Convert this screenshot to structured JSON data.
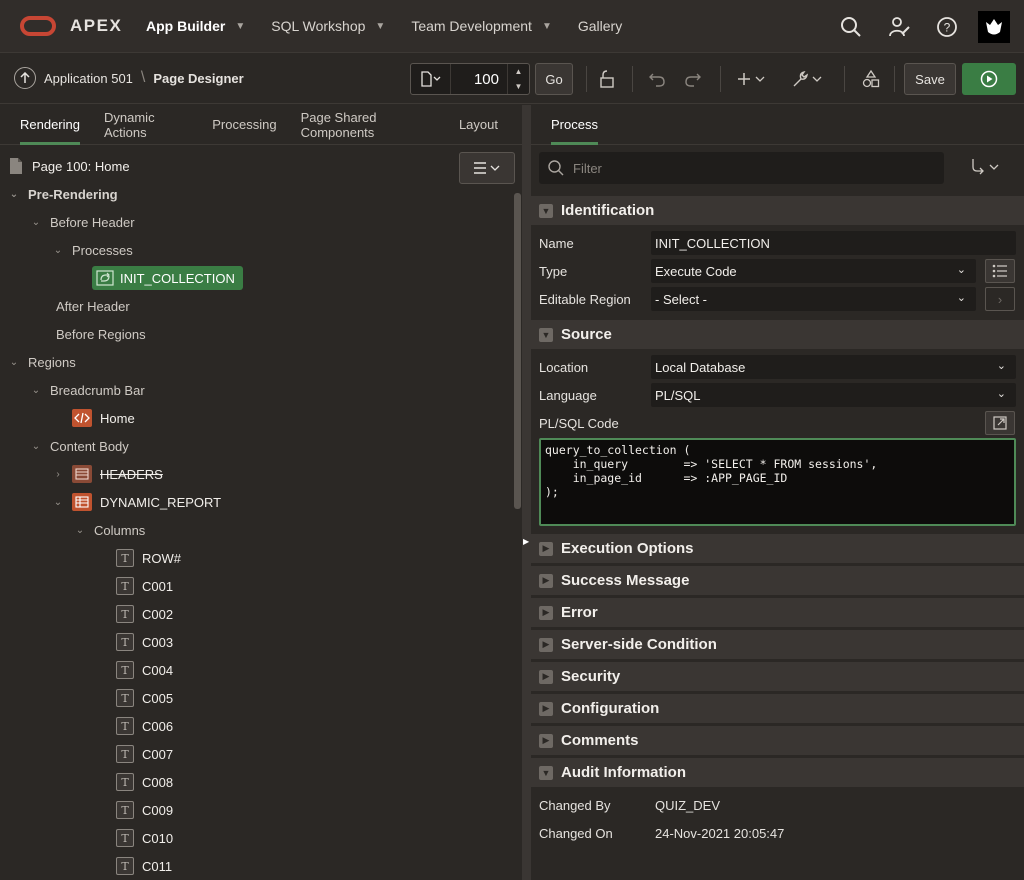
{
  "app": {
    "brand": "APEX"
  },
  "topnav": {
    "items": [
      "App Builder",
      "SQL Workshop",
      "Team Development",
      "Gallery"
    ]
  },
  "toolbar": {
    "app_crumb": "Application 501",
    "page_crumb": "Page Designer",
    "page_number": "100",
    "go_label": "Go",
    "save_label": "Save"
  },
  "left": {
    "tabs": [
      "Rendering",
      "Dynamic Actions",
      "Processing",
      "Page Shared Components",
      "Layout"
    ],
    "tree": {
      "page": "Page 100: Home",
      "pre_rendering": "Pre-Rendering",
      "before_header": "Before Header",
      "processes": "Processes",
      "init_collection": "INIT_COLLECTION",
      "after_header": "After Header",
      "before_regions": "Before Regions",
      "regions": "Regions",
      "breadcrumb_bar": "Breadcrumb Bar",
      "home": "Home",
      "content_body": "Content Body",
      "headers": "HEADERS",
      "dynamic_report": "DYNAMIC_REPORT",
      "columns": "Columns",
      "column_items": [
        "ROW#",
        "C001",
        "C002",
        "C003",
        "C004",
        "C005",
        "C006",
        "C007",
        "C008",
        "C009",
        "C010",
        "C011"
      ]
    }
  },
  "right": {
    "tab": "Process",
    "filter_placeholder": "Filter",
    "identification": {
      "title": "Identification",
      "name_label": "Name",
      "name_value": "INIT_COLLECTION",
      "type_label": "Type",
      "type_value": "Execute Code",
      "region_label": "Editable Region",
      "region_value": "- Select -"
    },
    "source": {
      "title": "Source",
      "location_label": "Location",
      "location_value": "Local Database",
      "language_label": "Language",
      "language_value": "PL/SQL",
      "code_label": "PL/SQL Code",
      "code": "query_to_collection (\n    in_query        => 'SELECT * FROM sessions',\n    in_page_id      => :APP_PAGE_ID\n);"
    },
    "collapsed_sections": [
      "Execution Options",
      "Success Message",
      "Error",
      "Server-side Condition",
      "Security",
      "Configuration",
      "Comments"
    ],
    "audit": {
      "title": "Audit Information",
      "changed_by_label": "Changed By",
      "changed_by_value": "QUIZ_DEV",
      "changed_on_label": "Changed On",
      "changed_on_value": "24-Nov-2021 20:05:47"
    }
  },
  "colors": {
    "accent_green": "#3a7d44",
    "brand_red": "#c74634",
    "region_icon": "#c0532f"
  }
}
